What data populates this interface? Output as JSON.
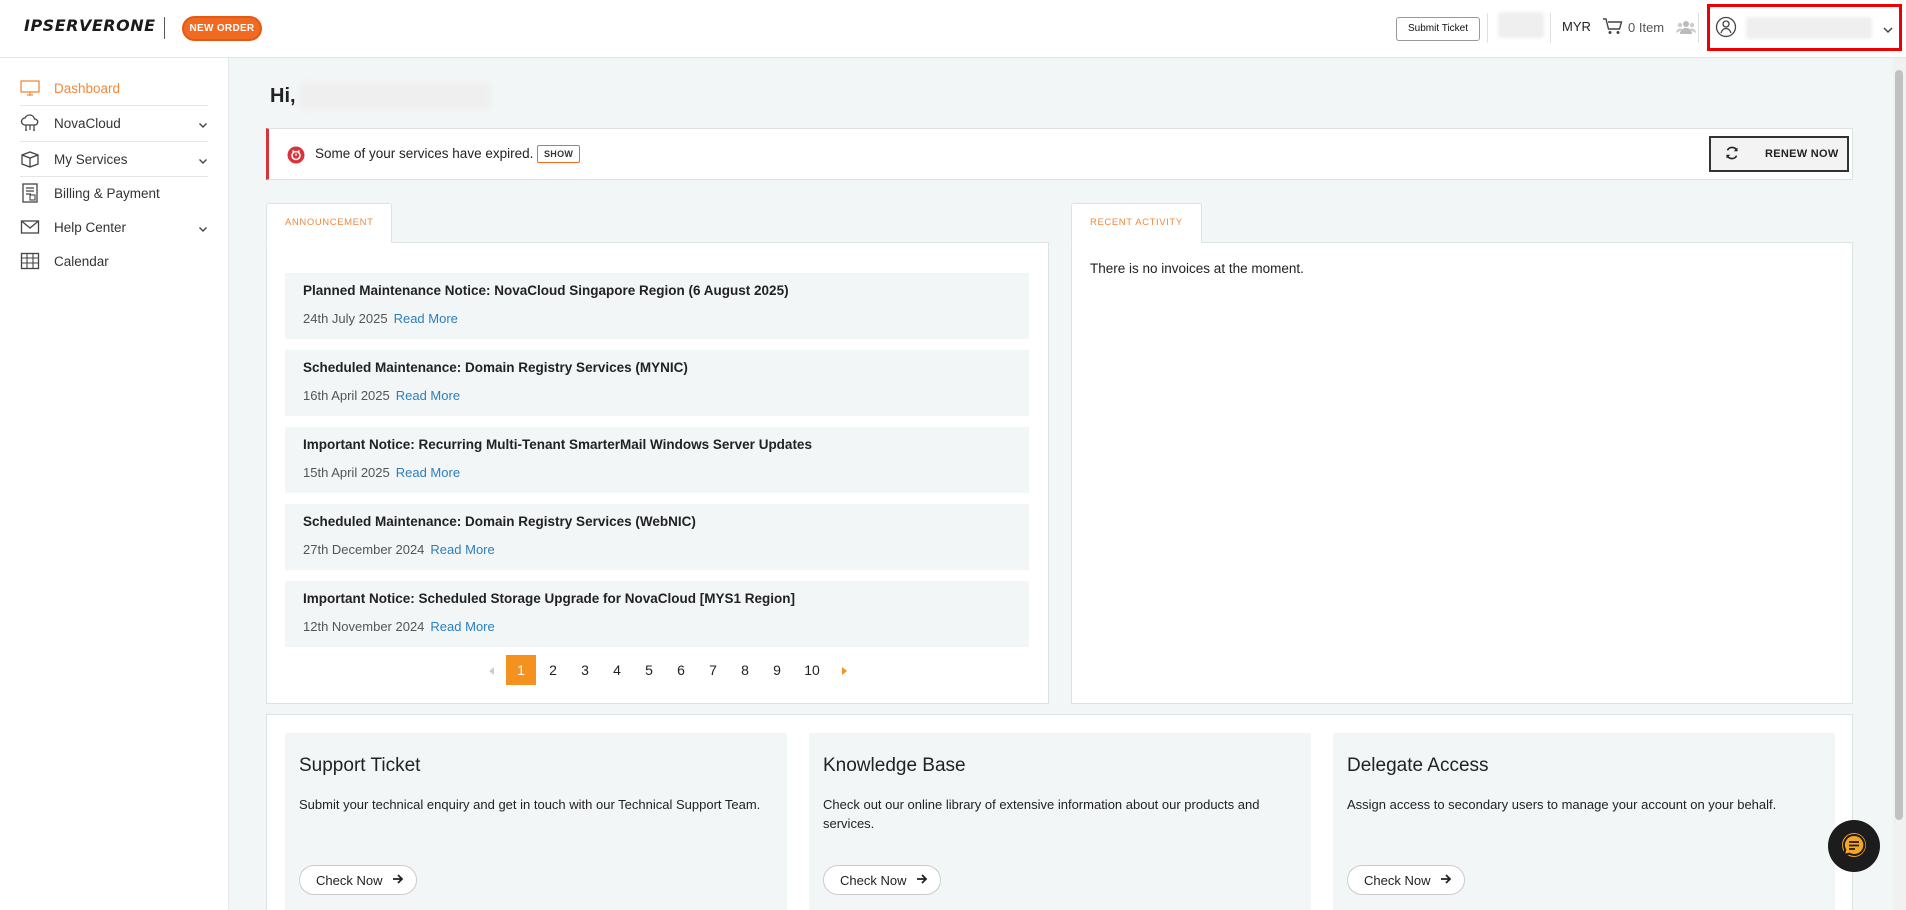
{
  "header": {
    "logo_text": "IPSERVERONE",
    "new_order_label": "NEW ORDER",
    "submit_ticket_label": "Submit Ticket",
    "currency": "MYR",
    "cart_label": "0 Item"
  },
  "sidebar": {
    "items": [
      {
        "label": "Dashboard",
        "icon": "monitor-icon",
        "active": true
      },
      {
        "label": "NovaCloud",
        "icon": "cloud-icon",
        "has_children": true
      },
      {
        "label": "My Services",
        "icon": "box-icon",
        "has_children": true
      },
      {
        "label": "Billing & Payment",
        "icon": "receipt-icon"
      },
      {
        "label": "Help Center",
        "icon": "mail-icon",
        "has_children": true
      },
      {
        "label": "Calendar",
        "icon": "calendar-icon"
      }
    ]
  },
  "main": {
    "greeting": "Hi,",
    "alert": {
      "text": "Some of your services have expired.",
      "show_label": "SHOW",
      "renew_label": "RENEW NOW"
    },
    "announcement": {
      "tab_label": "ANNOUNCEMENT",
      "read_more": "Read More",
      "items": [
        {
          "title": "Planned Maintenance Notice: NovaCloud Singapore Region (6 August 2025)",
          "date": "24th July 2025"
        },
        {
          "title": "Scheduled Maintenance: Domain Registry Services (MYNIC)",
          "date": "16th April 2025"
        },
        {
          "title": "Important Notice: Recurring Multi-Tenant SmarterMail Windows Server Updates",
          "date": "15th April 2025"
        },
        {
          "title": "Scheduled Maintenance: Domain Registry Services (WebNIC)",
          "date": "27th December 2024"
        },
        {
          "title": "Important Notice: Scheduled Storage Upgrade for NovaCloud [MYS1 Region]",
          "date": "12th November 2024"
        }
      ],
      "pages": [
        "1",
        "2",
        "3",
        "4",
        "5",
        "6",
        "7",
        "8",
        "9",
        "10"
      ],
      "current_page": "1"
    },
    "recent_activity": {
      "tab_label": "RECENT ACTIVITY",
      "empty_text": "There is no invoices at the moment."
    },
    "cards": [
      {
        "title": "Support Ticket",
        "desc": "Submit your technical enquiry and get in touch with our Technical Support Team.",
        "button": "Check Now"
      },
      {
        "title": "Knowledge Base",
        "desc": "Check out our online library of extensive information about our products and services.",
        "button": "Check Now"
      },
      {
        "title": "Delegate Access",
        "desc": "Assign access to secondary users to manage your account on your behalf.",
        "button": "Check Now"
      }
    ]
  },
  "colors": {
    "brand_orange": "#f06a22",
    "accent_orange": "#f0883e",
    "alert_red": "#d8323a",
    "link_blue": "#2a7fbf",
    "highlight_red": "#ee0000"
  }
}
